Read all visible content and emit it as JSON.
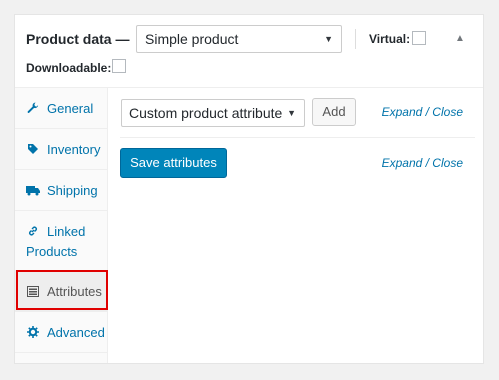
{
  "header": {
    "label": "Product data —",
    "product_type": {
      "selected": "Simple product"
    },
    "virtual_label": "Virtual:",
    "downloadable_label": "Downloadable:",
    "virtual_checked": false,
    "downloadable_checked": false
  },
  "tabs": [
    {
      "label": "General",
      "icon": "wrench-icon"
    },
    {
      "label": "Inventory",
      "icon": "tag-icon"
    },
    {
      "label": "Shipping",
      "icon": "truck-icon"
    },
    {
      "label": "Linked Products",
      "line1": "Linked",
      "line2": "Products",
      "icon": "link-icon"
    },
    {
      "label": "Attributes",
      "icon": "list-icon",
      "active": true
    },
    {
      "label": "Advanced",
      "icon": "gear-icon"
    }
  ],
  "attributes": {
    "select": {
      "selected": "Custom product attribute"
    },
    "add_button": "Add",
    "expand_close": "Expand / Close",
    "save_button": "Save attributes"
  },
  "colors": {
    "link": "#0073aa",
    "primary_button": "#0085ba",
    "highlight": "#e00000"
  }
}
